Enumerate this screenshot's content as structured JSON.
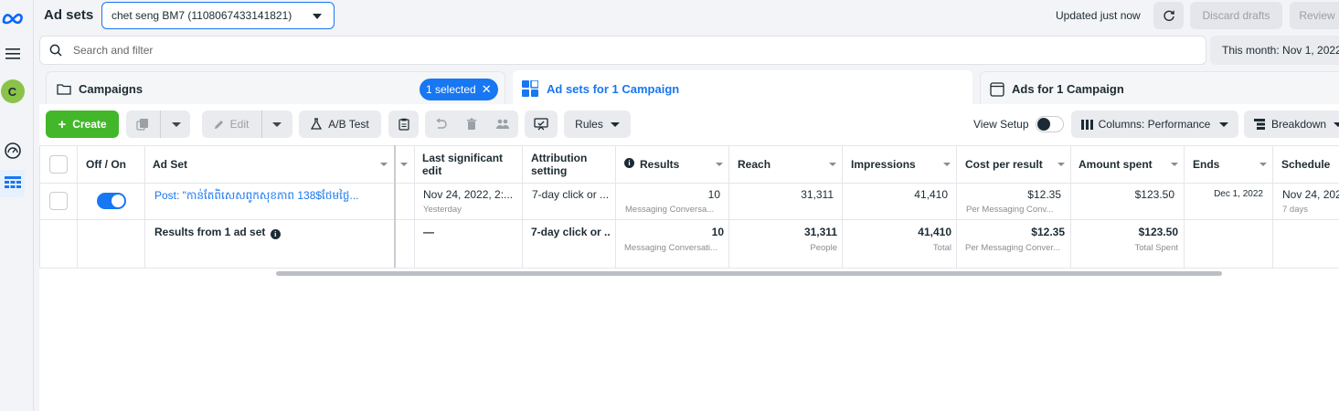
{
  "header": {
    "title": "Ad sets",
    "account_selector": "chet seng BM7 (1108067433141821)",
    "updated_status": "Updated just now",
    "discard_drafts": "Discard drafts",
    "review": "Review"
  },
  "nav": {
    "avatar_letter": "C",
    "icons": [
      "meta-logo-icon",
      "menu-icon",
      "dashboard-gauge-icon",
      "table-grid-icon"
    ]
  },
  "search": {
    "placeholder": "Search and filter",
    "date_range": "This month: Nov 1, 2022"
  },
  "tabs": {
    "campaigns": "Campaigns",
    "selected_pill": "1 selected",
    "adsets": "Ad sets for 1 Campaign",
    "ads": "Ads for 1 Campaign"
  },
  "toolbar": {
    "create": "Create",
    "edit": "Edit",
    "ab_test": "A/B Test",
    "rules": "Rules",
    "view_setup": "View Setup",
    "columns": "Columns: Performance",
    "breakdown": "Breakdown"
  },
  "table": {
    "headers": {
      "off_on": "Off / On",
      "adset": "Ad Set",
      "last_edit": "Last significant edit",
      "attribution": "Attribution setting",
      "results": "Results",
      "reach": "Reach",
      "impressions": "Impressions",
      "cost_per_result": "Cost per result",
      "amount_spent": "Amount spent",
      "ends": "Ends",
      "schedule": "Schedule"
    },
    "row": {
      "adset_name": "Post: \"កាន់តែពិសេសពូកសុខភាព 138$ថែមថ្លៃ...",
      "last_edit": "Nov 24, 2022, 2:...",
      "last_edit_sub": "Yesterday",
      "attribution": "7-day click or ...",
      "results": "10",
      "results_sub": "Messaging Conversa...",
      "reach": "31,311",
      "impressions": "41,410",
      "cost_per_result": "$12.35",
      "cost_per_result_sub": "Per Messaging Conv...",
      "amount_spent": "$123.50",
      "ends": "Dec 1, 2022",
      "schedule": "Nov 24, 202",
      "schedule_sub": "7 days"
    },
    "summary": {
      "label": "Results from 1 ad set",
      "last_edit": "—",
      "attribution": "7-day click or ...",
      "results": "10",
      "results_sub": "Messaging Conversati...",
      "reach": "31,311",
      "reach_sub": "People",
      "impressions": "41,410",
      "impressions_sub": "Total",
      "cost_per_result": "$12.35",
      "cost_per_result_sub": "Per Messaging Conver...",
      "amount_spent": "$123.50",
      "amount_spent_sub": "Total Spent"
    }
  },
  "colors": {
    "accent": "#1877f2",
    "create_green": "#42b72a",
    "avatar_green": "#8bc34a"
  }
}
